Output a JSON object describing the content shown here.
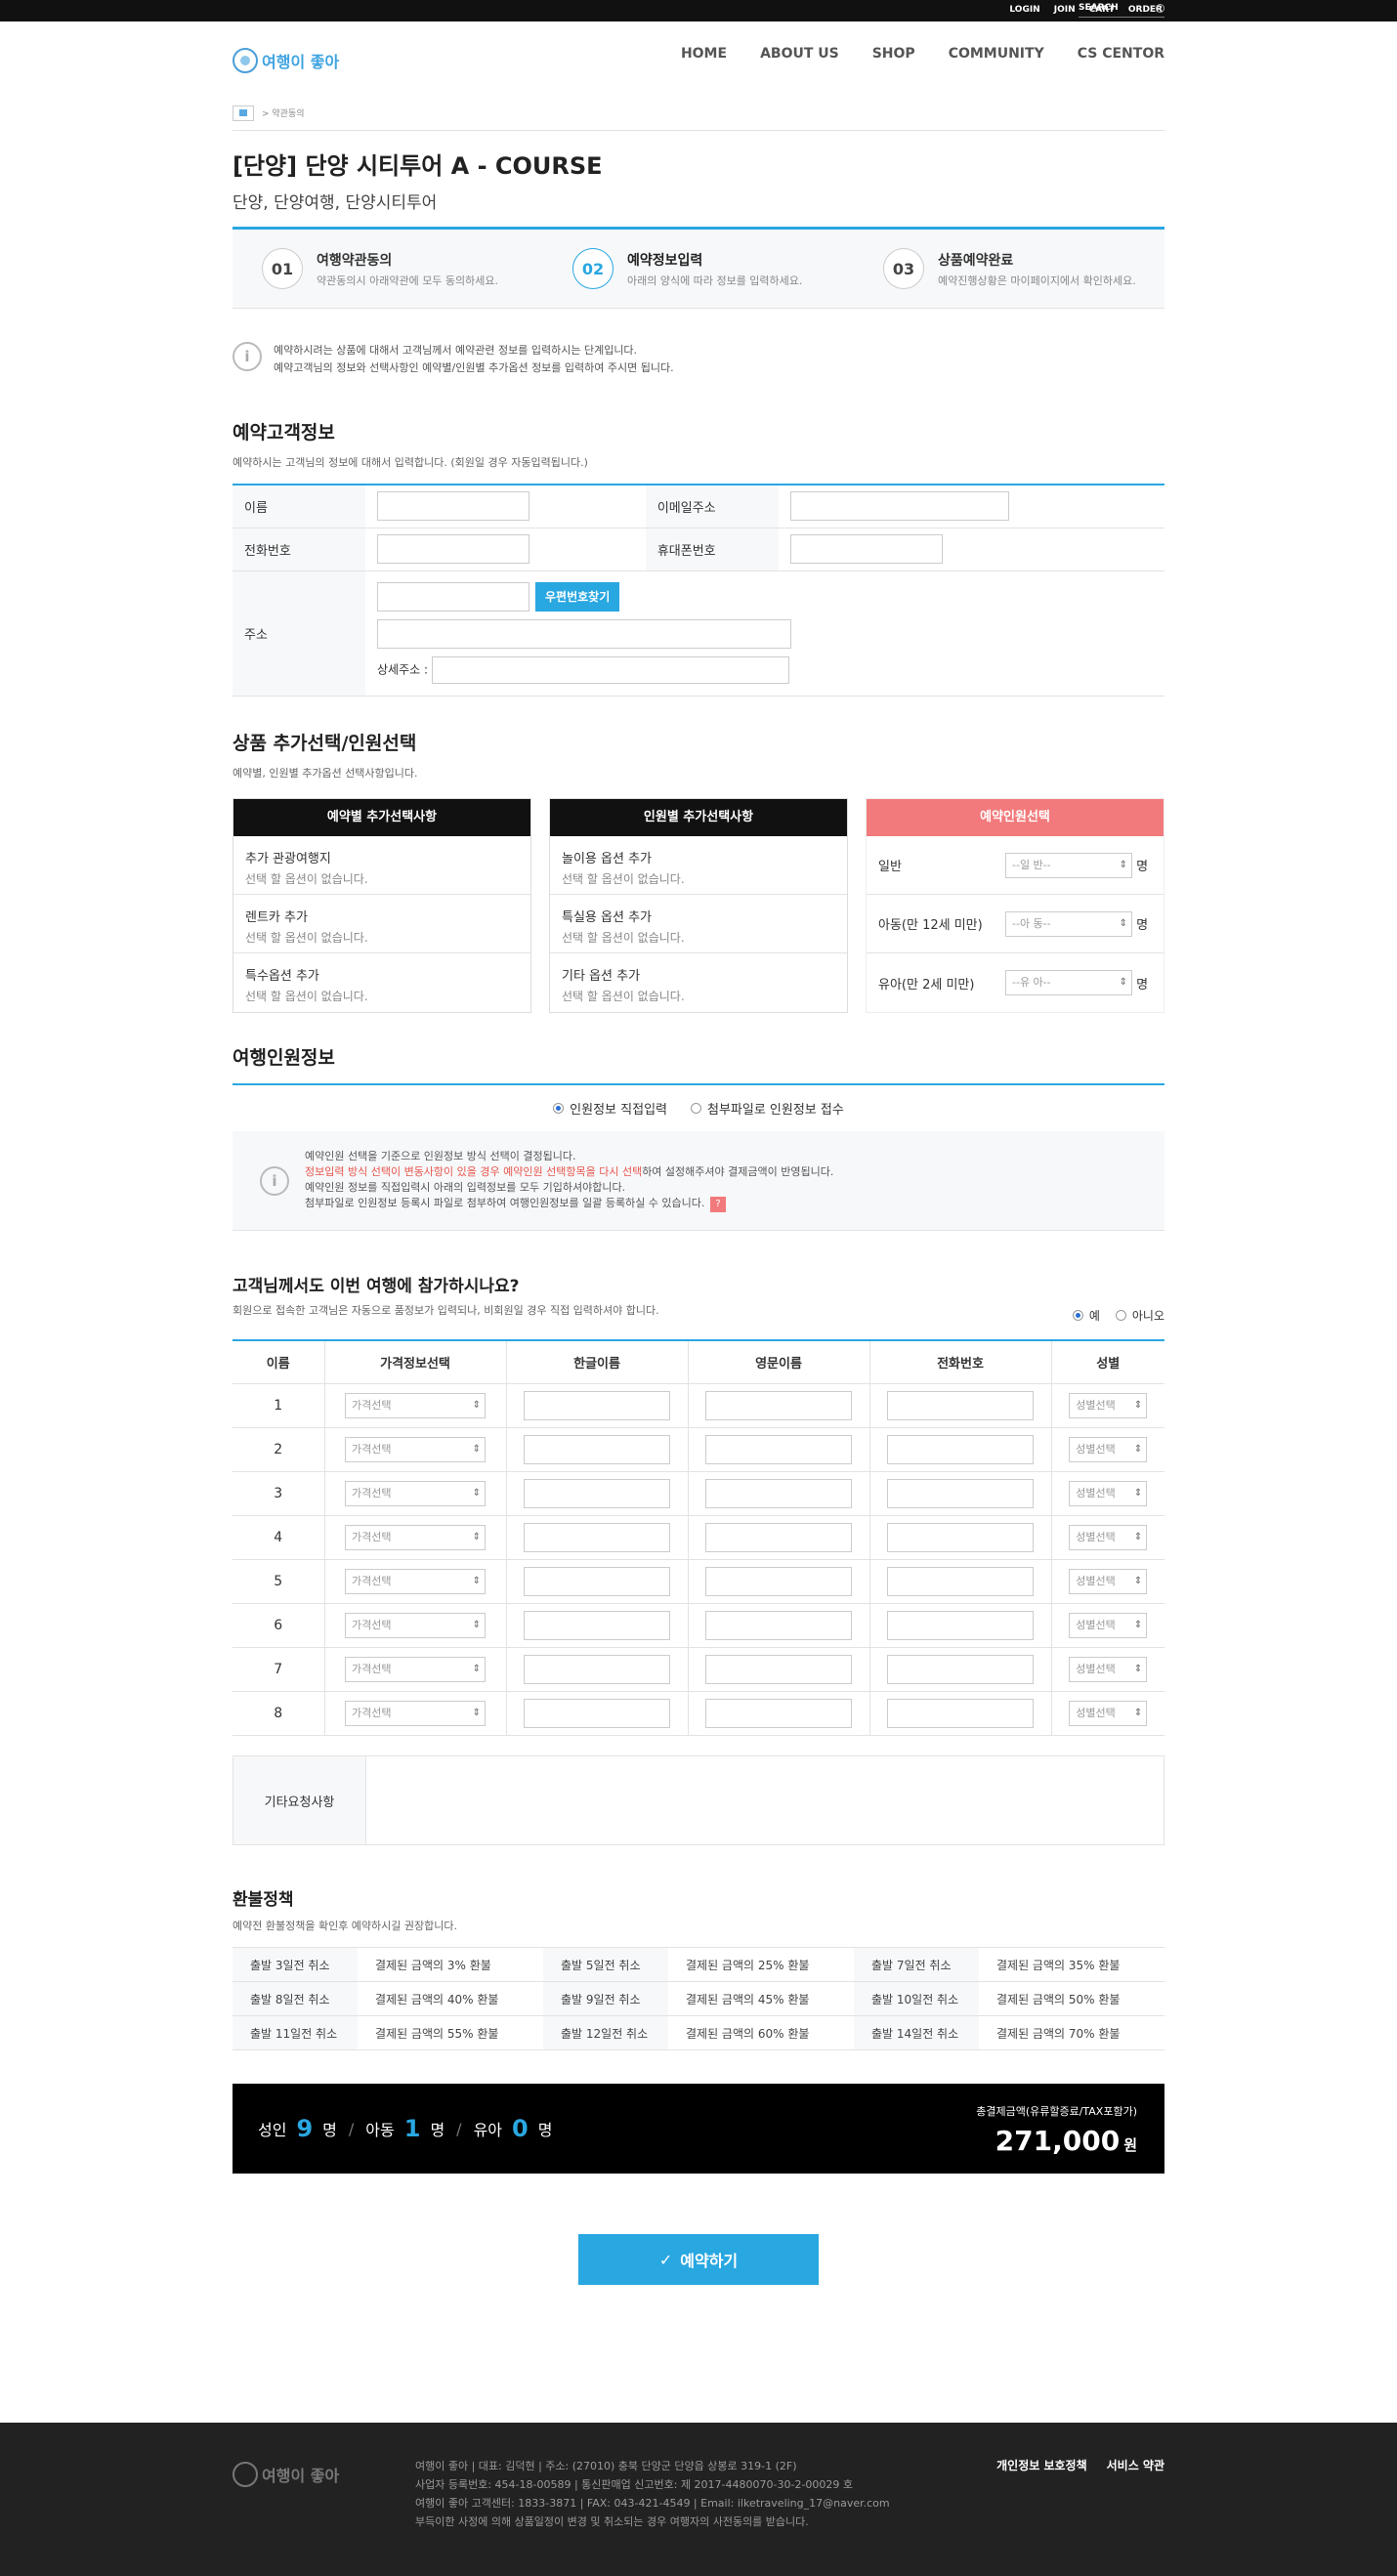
{
  "topbar": {
    "links": [
      "LOGIN",
      "JOIN",
      "CART",
      "ORDER"
    ],
    "search_label": "SEARCH"
  },
  "header": {
    "logo_text": "여행이 좋아",
    "nav": [
      "HOME",
      "ABOUT US",
      "SHOP",
      "COMMUNITY",
      "CS CENTOR"
    ]
  },
  "breadcrumb": {
    "current": "> 약관동의"
  },
  "product": {
    "title": "[단양] 단양 시티투어 A - COURSE",
    "tags": "단양, 단양여행, 단양시티투어"
  },
  "steps": [
    {
      "num": "01",
      "title": "여행약관동의",
      "desc": "약관동의시 아래약관에 모두 동의하세요."
    },
    {
      "num": "02",
      "title": "예약정보입력",
      "desc": "아래의 양식에 따라 정보를 입력하세요."
    },
    {
      "num": "03",
      "title": "상품예약완료",
      "desc": "예약진행상황은 마이페이지에서 확인하세요."
    }
  ],
  "notice": {
    "line1": "예약하시려는 상품에 대해서 고객님께서 예약관련 정보를 입력하시는 단계입니다.",
    "line2": "예약고객님의 정보와 선택사항인 예약별/인원별 추가옵션 정보를 입력하여 주시면 됩니다."
  },
  "customer": {
    "title": "예약고객정보",
    "sub": "예약하시는 고객님의 정보에 대해서 입력합니다. (회원일 경우 자동입력됩니다.)",
    "name": "이름",
    "email": "이메일주소",
    "phone": "전화번호",
    "mobile": "휴대폰번호",
    "address": "주소",
    "zip_button": "우편번호찾기",
    "detail_address": "상세주소 :"
  },
  "options": {
    "title": "상품 추가선택/인원선택",
    "sub": "예약별, 인원별 추가옵션 선택사항입니다.",
    "col1": {
      "header": "예약별 추가선택사항",
      "items": [
        {
          "name": "추가 관광여행지",
          "desc": "선택 할 옵션이 없습니다."
        },
        {
          "name": "렌트카 추가",
          "desc": "선택 할 옵션이 없습니다."
        },
        {
          "name": "특수옵션 추가",
          "desc": "선택 할 옵션이 없습니다."
        }
      ]
    },
    "col2": {
      "header": "인원별 추가선택사항",
      "items": [
        {
          "name": "놀이용 옵션 추가",
          "desc": "선택 할 옵션이 없습니다."
        },
        {
          "name": "특실용 옵션 추가",
          "desc": "선택 할 옵션이 없습니다."
        },
        {
          "name": "기타 옵션 추가",
          "desc": "선택 할 옵션이 없습니다."
        }
      ]
    },
    "col3": {
      "header": "예약인원선택",
      "rows": [
        {
          "label": "일반",
          "select": "--일 반--",
          "unit": "명"
        },
        {
          "label": "아동(만 12세 미만)",
          "select": "--아 동--",
          "unit": "명"
        },
        {
          "label": "유아(만 2세 미만)",
          "select": "--유 아--",
          "unit": "명"
        }
      ]
    }
  },
  "travelers": {
    "title": "여행인원정보",
    "radio1": "인원정보 직접입력",
    "radio2": "첨부파일로 인원정보 접수",
    "info1": "예약인원 선택을 기준으로 인원정보 방식 선택이 결정됩니다.",
    "info2_red": "정보입력 방식 선택이 변동사항이 있을 경우 예약인원 선택항목을 다시 선택",
    "info2_rest": "하여 설정해주셔야 결제금액이 반영됩니다.",
    "info3": "예약인원 정보를 직접입력시 아래의 입력정보를 모두 기입하셔야합니다.",
    "info4": "첨부파일로 인원정보 등록시 파일로 첨부하여 여행인원정보를 일괄 등록하실 수 있습니다.",
    "badge": "?"
  },
  "participate": {
    "title": "고객님께서도 이번 여행에 참가하시나요?",
    "sub": "회원으로 접속한 고객님은 자동으로 품정보가 입력되나, 비회원일 경우 직접 입력하셔야 합니다.",
    "yes": "예",
    "no": "아니오",
    "headers": [
      "이름",
      "가격정보선택",
      "한글이름",
      "영문이름",
      "전화번호",
      "성별"
    ],
    "rows": [
      "1",
      "2",
      "3",
      "4",
      "5",
      "6",
      "7",
      "8"
    ],
    "price_select": "가격선택",
    "gender_select": "성별선택"
  },
  "etc": {
    "label": "기타요청사항"
  },
  "refund": {
    "title": "환불정책",
    "sub": "예약전 환불정책을 확인후 예약하시길 권장합니다.",
    "rows": [
      [
        {
          "k": "출발 3일전 취소",
          "v": "결제된 금액의 3% 환불"
        },
        {
          "k": "출발 5일전 취소",
          "v": "결제된 금액의 25% 환불"
        },
        {
          "k": "출발 7일전 취소",
          "v": "결제된 금액의 35% 환불"
        }
      ],
      [
        {
          "k": "출발 8일전 취소",
          "v": "결제된 금액의 40% 환불"
        },
        {
          "k": "출발 9일전 취소",
          "v": "결제된 금액의 45% 환불"
        },
        {
          "k": "출발 10일전 취소",
          "v": "결제된 금액의 50% 환불"
        }
      ],
      [
        {
          "k": "출발 11일전 취소",
          "v": "결제된 금액의 55% 환불"
        },
        {
          "k": "출발 12일전 취소",
          "v": "결제된 금액의 60% 환불"
        },
        {
          "k": "출발 14일전 취소",
          "v": "결제된 금액의 70% 환불"
        }
      ]
    ]
  },
  "summary": {
    "adult_label": "성인",
    "adult": "9",
    "child_label": "아동",
    "child": "1",
    "infant_label": "유아",
    "infant": "0",
    "unit": "명",
    "total_label": "총결제금액(유류할증료/TAX포함가)",
    "total": "271,000",
    "currency": "원"
  },
  "book_button": "예약하기",
  "footer": {
    "logo_text": "여행이 좋아",
    "line1": "여행이 좋아 | 대표: 김덕현 | 주소: (27010) 충북 단양군 단양읍 상봉로 319-1 (2F)",
    "line2": "사업자 등록번호: 454-18-00589 | 통신판매업 신고번호: 제 2017-4480070-30-2-00029 호",
    "line3": "여행이 좋아 고객센터: 1833-3871 | FAX: 043-421-4549 | Email: ilketraveling_17@naver.com",
    "line4": "부득이한 사정에 의해 상품일정이 변경 및 취소되는 경우 여행자의 사전동의를 받습니다.",
    "links": [
      "개인정보 보호정책",
      "서비스 약관"
    ]
  },
  "colors": {
    "accent": "#29a7e1",
    "pink": "#f27a7c",
    "dark": "#111111"
  }
}
